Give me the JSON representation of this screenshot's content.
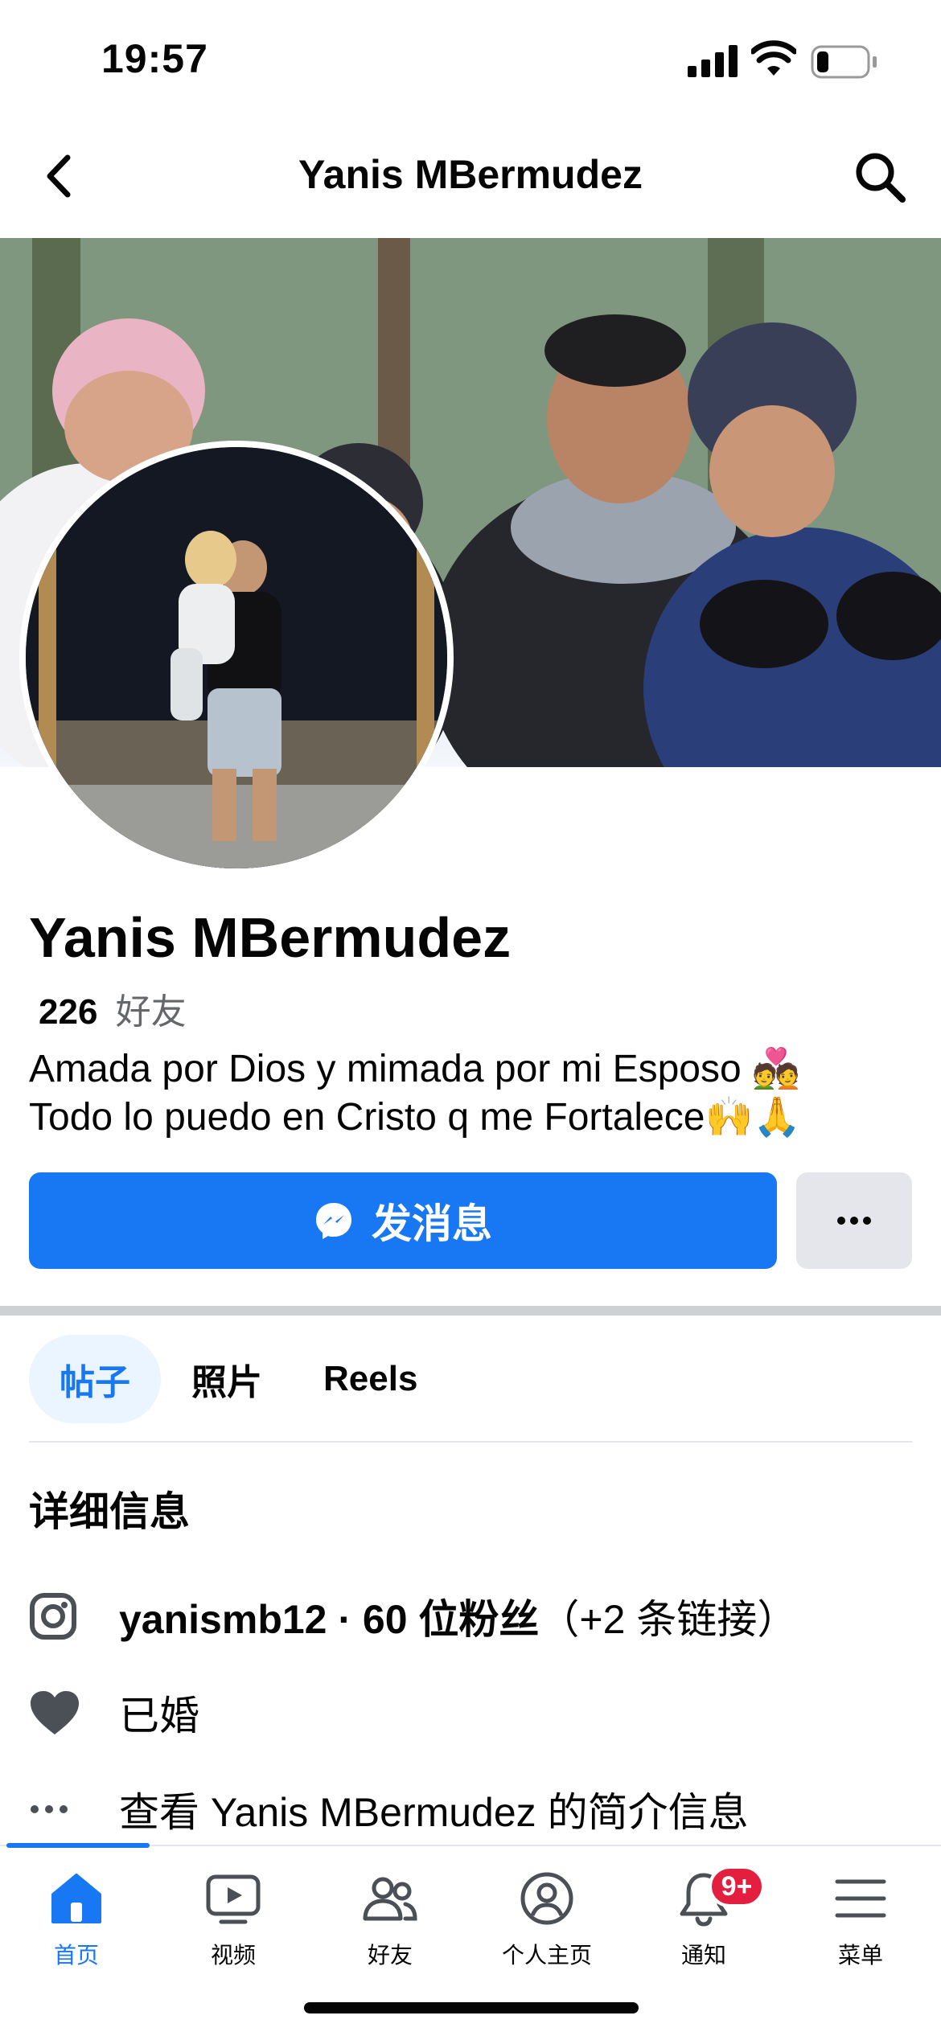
{
  "status_bar": {
    "time": "19:57",
    "battery_level": 0.2
  },
  "header": {
    "title": "Yanis MBermudez"
  },
  "profile": {
    "name": "Yanis MBermudez",
    "friends_count": "226",
    "friends_label": "好友",
    "bio_line1": "Amada por Dios y mimada por mi Esposo 💑",
    "bio_line2": "Todo lo puedo en Cristo q me Fortalece🙌🙏"
  },
  "actions": {
    "message_label": "发消息"
  },
  "tabs": [
    {
      "label": "帖子",
      "active": true
    },
    {
      "label": "照片",
      "active": false
    },
    {
      "label": "Reels",
      "active": false
    }
  ],
  "details": {
    "title": "详细信息",
    "instagram": "yanismb12 · 60 位粉丝",
    "instagram_links": "（+2 条链接）",
    "relationship": "已婚",
    "about_link": "查看 Yanis MBermudez 的简介信息"
  },
  "bottom_nav": [
    {
      "label": "首页",
      "icon": "home-icon",
      "active": true
    },
    {
      "label": "视频",
      "icon": "video-icon",
      "active": false
    },
    {
      "label": "好友",
      "icon": "friends-icon",
      "active": false
    },
    {
      "label": "个人主页",
      "icon": "profile-icon",
      "active": false
    },
    {
      "label": "通知",
      "icon": "bell-icon",
      "active": false,
      "badge": "9+"
    },
    {
      "label": "菜单",
      "icon": "menu-icon",
      "active": false
    }
  ],
  "colors": {
    "accent": "#1877f2",
    "badge": "#e41e3f",
    "secondary_button": "#e4e6eb"
  }
}
